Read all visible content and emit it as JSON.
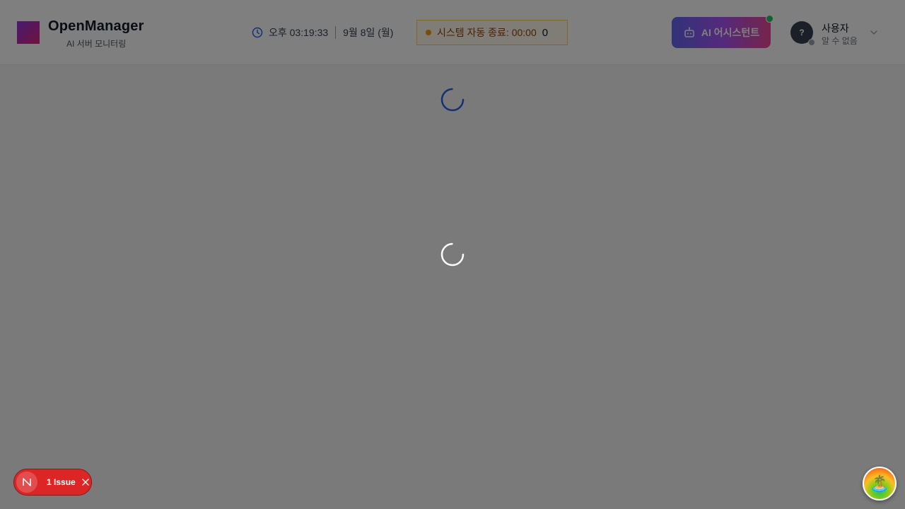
{
  "brand": {
    "name": "OpenManager",
    "subtitle": "AI 서버 모니터링"
  },
  "clock": {
    "time": "오후 03:19:33",
    "date": "9월 8일 (월)"
  },
  "auto_shutdown": {
    "label": "시스템 자동 종료: 00:00",
    "count": "0"
  },
  "ai_assistant": {
    "label": "AI 어시스턴트",
    "online": true
  },
  "user": {
    "avatar": "?",
    "name": "사용자",
    "role": "알 수 없음"
  },
  "issue_badge": {
    "label": "1 Issue"
  },
  "bubble": {
    "emoji": "🏝️"
  },
  "colors": {
    "overlay": "rgba(0,0,0,0.5)",
    "accent_blue": "#2563eb",
    "issue_red": "#dc2626",
    "online_green": "#22c55e",
    "amber": "#f59e0b"
  },
  "icons": {
    "logo": "gradient-square",
    "clock": "clock-icon",
    "status_dot": "amber-dot",
    "ai": "robot-icon",
    "chevron": "chevron-down-icon",
    "loading": "spinner-icon",
    "issue": "n-logo-icon",
    "close": "close-icon"
  }
}
